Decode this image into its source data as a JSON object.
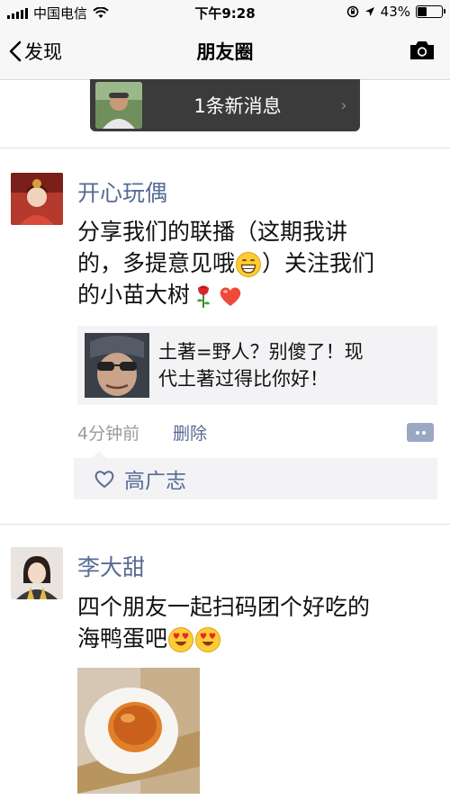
{
  "status_bar": {
    "carrier": "中国电信",
    "time": "下午9:28",
    "battery": "43%",
    "battery_level": 0.43
  },
  "nav": {
    "back_label": "发现",
    "title": "朋友圈"
  },
  "banner": {
    "text": "1条新消息"
  },
  "posts": [
    {
      "author": "开心玩偶",
      "text_line1": "分享我们的联播（这期我讲",
      "text_line2_a": "的，多提意见哦",
      "text_line2_b": "）关注我们",
      "text_line3": "的小苗大树",
      "shared_title_line1": "土著=野人？别傻了！现",
      "shared_title_line2": "代土著过得比你好！",
      "time": "4分钟前",
      "delete_label": "删除",
      "likes": [
        "高广志"
      ]
    },
    {
      "author": "李大甜",
      "text_line1": "四个朋友一起扫码团个好吃的",
      "text_line2": "海鸭蛋吧"
    }
  ],
  "colors": {
    "name_link": "#576b95",
    "banner_bg": "#3b3b3b",
    "card_bg": "#f3f3f5"
  }
}
